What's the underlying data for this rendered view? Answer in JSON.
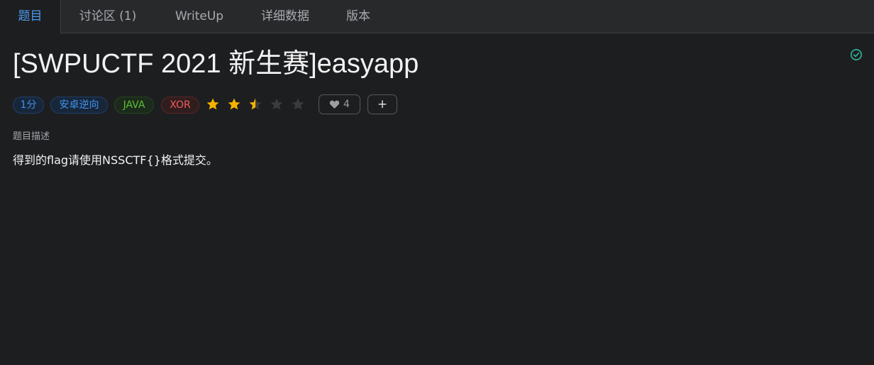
{
  "tabs": [
    {
      "label": "题目",
      "active": true
    },
    {
      "label": "讨论区 (1)",
      "active": false
    },
    {
      "label": "WriteUp",
      "active": false
    },
    {
      "label": "详细数据",
      "active": false
    },
    {
      "label": "版本",
      "active": false
    }
  ],
  "challenge": {
    "title": "[SWPUCTF 2021 新生赛]easyapp",
    "solved_icon": "check-circle-icon",
    "tags": {
      "score": "1分",
      "category": "安卓逆向",
      "tag1": "JAVA",
      "tag2": "XOR"
    },
    "rating": {
      "value": 2.5,
      "max": 5
    },
    "likes": {
      "icon": "heart-icon",
      "count": "4"
    },
    "add_label": "+"
  },
  "description": {
    "label": "题目描述",
    "text": "得到的flag请使用NSSCTF{}格式提交。"
  },
  "colors": {
    "accent": "#4a9cf0",
    "background": "#1d1e20",
    "star_filled": "#f5b301",
    "star_empty": "#3a3b3e",
    "solved": "#2fb99d"
  }
}
